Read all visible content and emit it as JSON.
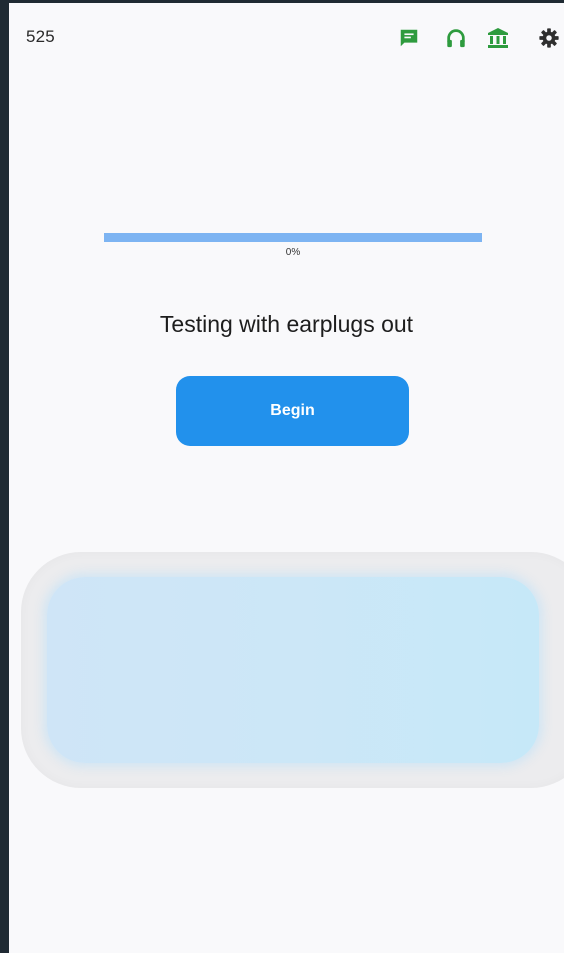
{
  "status_bar": {
    "value": "525",
    "icons": [
      "chat-icon",
      "headphones-icon",
      "bank-icon",
      "gear-icon"
    ],
    "icon_color": "#2e9b3e",
    "gear_color": "#2f2f2f"
  },
  "progress": {
    "fraction": 0,
    "label": "0%"
  },
  "main": {
    "heading": "Testing with earplugs out",
    "begin_label": "Begin"
  },
  "colors": {
    "accent": "#2291ec",
    "progress_track": "#7db4f2",
    "panel": "#cce7f7"
  }
}
